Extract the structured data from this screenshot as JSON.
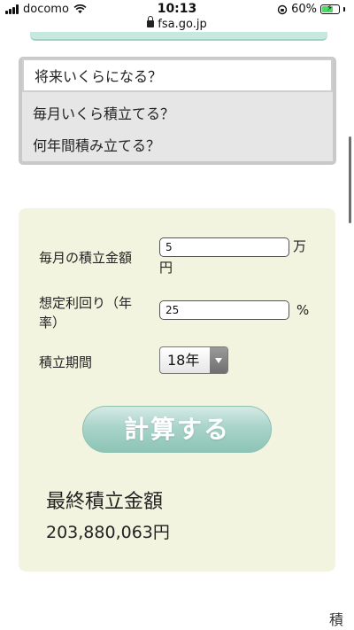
{
  "status_bar": {
    "carrier": "docomo",
    "time": "10:13",
    "battery": "60%",
    "battery_level": 0.6,
    "url": "fsa.go.jp"
  },
  "options": {
    "items": [
      {
        "label": "将来いくらになる？",
        "selected": true
      },
      {
        "label": "毎月いくら積立てる？",
        "selected": false
      },
      {
        "label": "何年間積み立てる？",
        "selected": false
      }
    ]
  },
  "calculator": {
    "monthly_label": "毎月の積立金額",
    "monthly_value": "5",
    "monthly_unit": "万円",
    "rate_label": "想定利回り（年率）",
    "rate_value": "25",
    "rate_unit": "%",
    "period_label": "積立期間",
    "period_value": "18年",
    "calc_button": "計算する",
    "result_title": "最終積立金額",
    "result_value": "203,880,063円"
  },
  "footer": {
    "corner_text": "積"
  },
  "colors": {
    "panel_bg": "#f3f4df",
    "button_teal": "#a9d4ca",
    "menu_bg": "#e6e6e6"
  }
}
